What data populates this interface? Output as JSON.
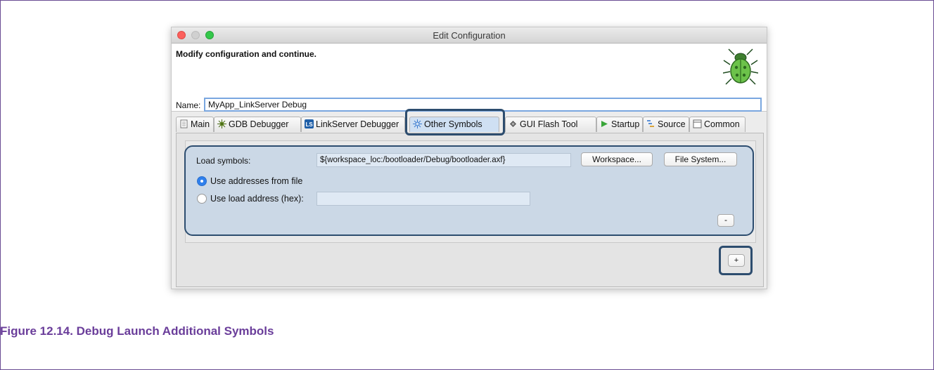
{
  "window": {
    "title": "Edit Configuration",
    "banner_message": "Modify configuration and continue."
  },
  "name_field": {
    "label": "Name:",
    "value": "MyApp_LinkServer Debug"
  },
  "tabs": [
    {
      "label": "Main",
      "icon": "document-icon"
    },
    {
      "label": "GDB Debugger",
      "icon": "bug-star-icon"
    },
    {
      "label": "LinkServer Debugger",
      "icon": "ls-icon"
    },
    {
      "label": "Other Symbols",
      "icon": "symbols-icon",
      "active": true
    },
    {
      "label": "GUI Flash Tool",
      "icon": "chip-icon"
    },
    {
      "label": "Startup",
      "icon": "play-icon"
    },
    {
      "label": "Source",
      "icon": "source-icon"
    },
    {
      "label": "Common",
      "icon": "window-icon"
    }
  ],
  "symbols": {
    "load_label": "Load symbols:",
    "path_value": "${workspace_loc:/bootloader/Debug/bootloader.axf}",
    "workspace_button": "Workspace...",
    "filesystem_button": "File System...",
    "radio_file": "Use addresses from file",
    "radio_hex": "Use load address (hex):",
    "hex_value": "",
    "remove_button": "-",
    "add_button": "+"
  },
  "caption": "Figure 12.14. Debug Launch Additional Symbols",
  "colors": {
    "highlight": "#2d4d6f",
    "caption": "#6a3d9a",
    "selection": "#cbd8e6"
  }
}
